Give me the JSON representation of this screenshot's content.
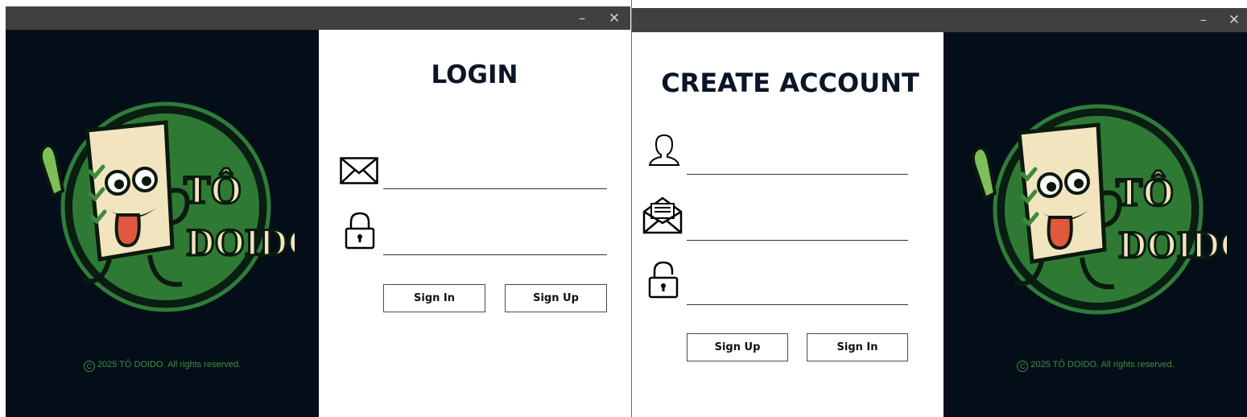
{
  "login_window": {
    "controls": {
      "minimize": "–",
      "close": "✕"
    },
    "brand": {
      "logo_line1": "TÔ",
      "logo_line2": "DOIDO",
      "copyright_symbol": "C",
      "copyright": "2025 TÔ DOIDO. All rights reserved."
    },
    "form": {
      "title": "LOGIN",
      "email_value": "",
      "password_value": "",
      "sign_in_label": "Sign In",
      "sign_up_label": "Sign Up"
    }
  },
  "signup_window": {
    "controls": {
      "minimize": "–",
      "close": "✕"
    },
    "brand": {
      "logo_line1": "TÔ",
      "logo_line2": "DOIDO",
      "copyright_symbol": "C",
      "copyright": "2025 TÔ DOIDO. All rights reserved."
    },
    "form": {
      "title": "CREATE ACCOUNT",
      "username_value": "",
      "email_value": "",
      "password_value": "",
      "sign_up_label": "Sign Up",
      "sign_in_label": "Sign In"
    }
  },
  "colors": {
    "titlebar": "#404040",
    "brand_background": "#030e19",
    "logo_green": "#2f7d3a",
    "copyright_green": "#3f8f3f",
    "title_text": "#0b1526"
  }
}
